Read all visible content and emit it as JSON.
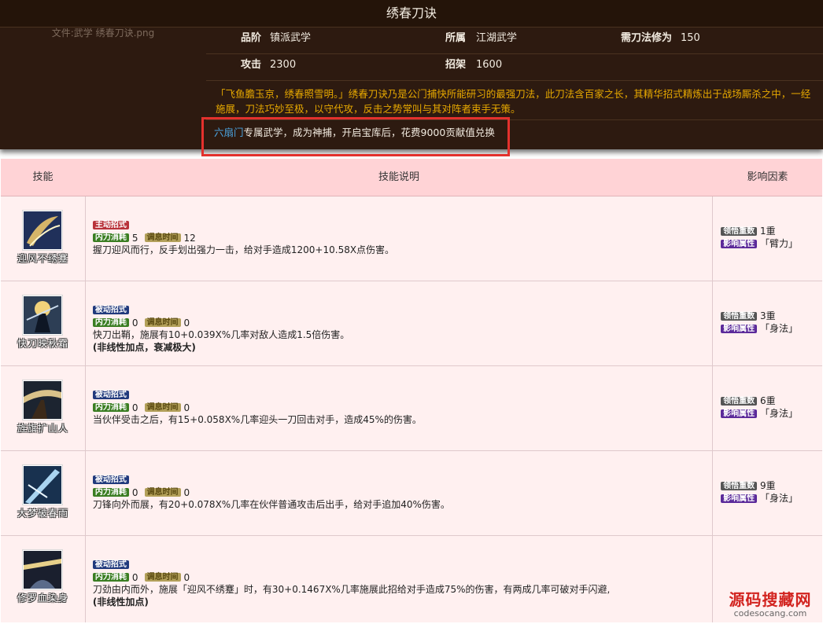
{
  "panel": {
    "title": "绣春刀诀",
    "file_label": "文件:武学 绣春刀诀.png",
    "rank_label": "品阶",
    "rank_value": "镇派武学",
    "belong_label": "所属",
    "belong_value": "江湖武学",
    "req_label": "需刀法修为",
    "req_value": "150",
    "atk_label": "攻击",
    "atk_value": "2300",
    "def_label": "招架",
    "def_value": "1600",
    "description": "「飞鱼膽玉京，绣春照雪明。」绣春刀诀乃是公门捕快所能研习的最强刀法，此刀法含百家之长，其精华招式精炼出于战场厮杀之中，一经施展，刀法巧妙至极，以守代攻，反击之势常叫与其对阵者束手无策。",
    "source_link": "六扇门",
    "source_rest": "专属武学，成为神捕，开启宝库后，花费9000贡献值兑换"
  },
  "table": {
    "col_skill": "技能",
    "col_desc": "技能说明",
    "col_factor": "影响因素",
    "labels": {
      "active": "主动招式",
      "passive": "被动招式",
      "mp": "内力消耗",
      "cd": "调息时间",
      "layer": "领悟重数",
      "attr": "影响属性"
    },
    "rows": [
      {
        "name": "迎风不绣蹇",
        "type": "主动招式",
        "mp": "5",
        "cd": "12",
        "text": "握刀迎风而行，反手划出强力一击，给对手造成1200+10.58X点伤害。",
        "note": "",
        "layer": "1重",
        "attr": "「臂力」"
      },
      {
        "name": "快刀映秋霜",
        "type": "被动招式",
        "mp": "0",
        "cd": "0",
        "text": "快刀出鞘，施展有10+0.039X%几率对敌人造成1.5倍伤害。",
        "note": "(非线性加点，衰减极大)",
        "layer": "3重",
        "attr": "「身法」"
      },
      {
        "name": "旌旗扩山人",
        "type": "被动招式",
        "mp": "0",
        "cd": "0",
        "text": "当伙伴受击之后，有15+0.058X%几率迎头一刀回击对手，造成45%的伤害。",
        "note": "",
        "layer": "6重",
        "attr": "「身法」"
      },
      {
        "name": "大梦破春雨",
        "type": "被动招式",
        "mp": "0",
        "cd": "0",
        "text": "刀锋向外而展，有20+0.078X%几率在伙伴普通攻击后出手，给对手追加40%伤害。",
        "note": "",
        "layer": "9重",
        "attr": "「身法」"
      },
      {
        "name": "修罗血染身",
        "type": "被动招式",
        "mp": "0",
        "cd": "0",
        "text": "刀劲由内而外，施展「迎风不绣蹇」时，有30+0.1467X%几率施展此招给对手造成75%的伤害，有两成几率可破对手闪避,",
        "note": "(非线性加点)",
        "layer": "",
        "attr": ""
      }
    ]
  },
  "watermark": {
    "cn": "源码搜藏网",
    "en": "codesocang.com"
  },
  "colors": {
    "panel_bg": "#2d1a10",
    "desc_text": "#e6a800",
    "link": "#4aa3df",
    "highlight_border": "#e3312d",
    "table_header": "#ffd3d6",
    "table_bg": "#fff0f0"
  }
}
